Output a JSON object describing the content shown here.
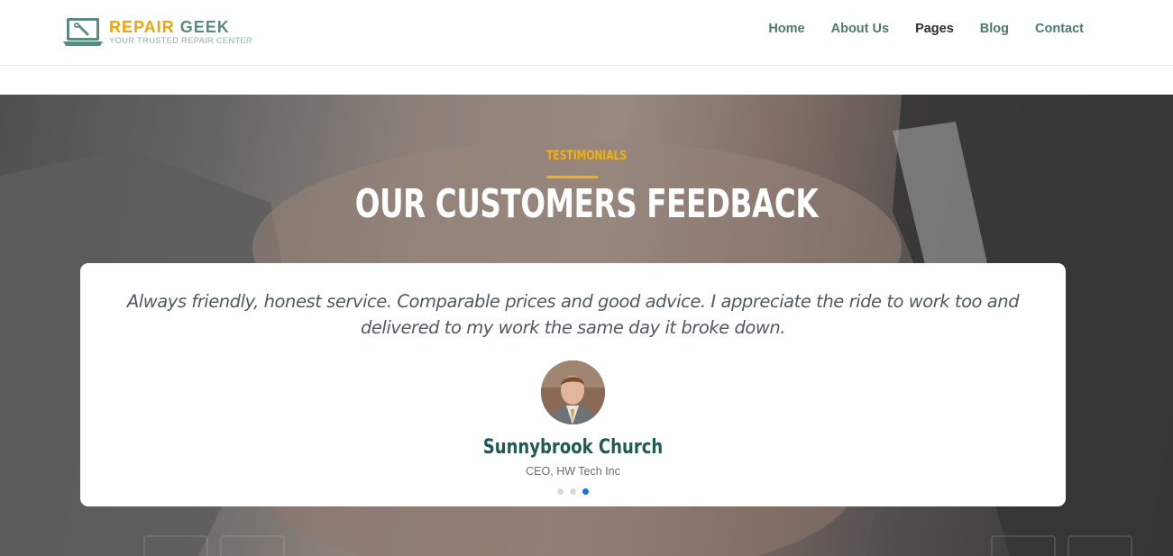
{
  "header": {
    "brand_word1": "REPAIR",
    "brand_word2": "GEEK",
    "tagline": "YOUR TRUSTED REPAIR CENTER",
    "logo_icon": "laptop-wrench-icon",
    "nav": [
      {
        "label": "Home"
      },
      {
        "label": "About Us"
      },
      {
        "label": "Pages"
      },
      {
        "label": "Blog"
      },
      {
        "label": "Contact"
      }
    ]
  },
  "hero": {
    "kicker": "TESTIMONIALS",
    "title": "OUR CUSTOMERS FEEDBACK",
    "background": "handshake-photo"
  },
  "testimonial": {
    "quote": "Always friendly, honest service. Comparable prices and good advice. I appreciate the ride to work too and delivered to my work the same day it broke down.",
    "name": "Sunnybrook Church",
    "role": "CEO, HW Tech Inc",
    "active_slide": 3,
    "slide_count": 3
  },
  "colors": {
    "accent_yellow": "#f2b10e",
    "brand_green": "#5b8a7e",
    "name_teal": "#1f5a58",
    "dot_active": "#1a6fe0"
  }
}
